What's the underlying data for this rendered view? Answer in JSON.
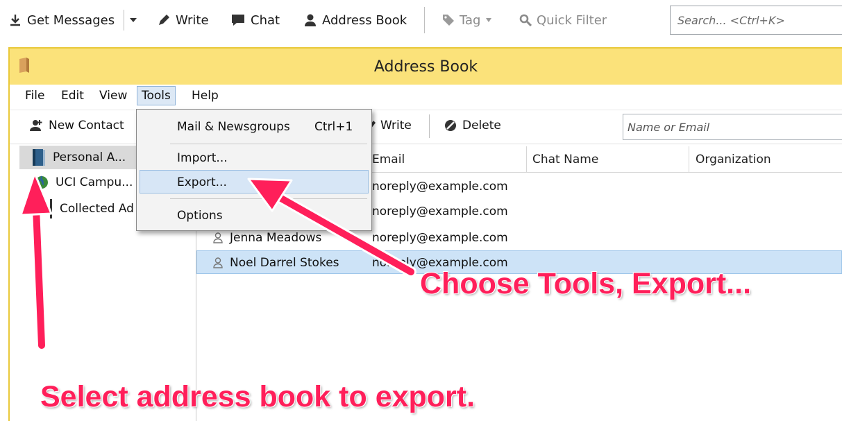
{
  "toolbar": {
    "get_messages": "Get Messages",
    "write": "Write",
    "chat": "Chat",
    "address_book": "Address Book",
    "tag": "Tag",
    "quick_filter": "Quick Filter",
    "search_placeholder": "Search... <Ctrl+K>"
  },
  "window": {
    "title": "Address Book",
    "menus": [
      "File",
      "Edit",
      "View",
      "Tools",
      "Help"
    ],
    "open_menu": "Tools",
    "ab_toolbar": {
      "new_contact": "New Contact",
      "write": "Write",
      "delete": "Delete",
      "filter_placeholder": "Name or Email"
    },
    "books": [
      {
        "label": "Personal A...",
        "selected": true
      },
      {
        "label": "UCI Campu..."
      },
      {
        "label": "Collected Ad"
      }
    ],
    "columns": [
      "Email",
      "Chat Name",
      "Organization"
    ],
    "contacts": [
      {
        "name": "",
        "email": "noreply@example.com"
      },
      {
        "name": "",
        "email": "noreply@example.com"
      },
      {
        "name": "Jenna Meadows",
        "email": "noreply@example.com"
      },
      {
        "name": "Noel Darrel Stokes",
        "email": "noreply@example.com",
        "selected": true
      }
    ],
    "tools_menu": {
      "mail_newsgroups": "Mail & Newsgroups",
      "mail_shortcut": "Ctrl+1",
      "import": "Import...",
      "export": "Export...",
      "options": "Options"
    }
  },
  "annotations": {
    "tools_hint": "Choose Tools, Export...",
    "book_hint": "Select address book to export."
  },
  "colors": {
    "annotation": "#ff1f5a",
    "titlebar": "#fbe27a",
    "selection": "#cde3f7"
  }
}
